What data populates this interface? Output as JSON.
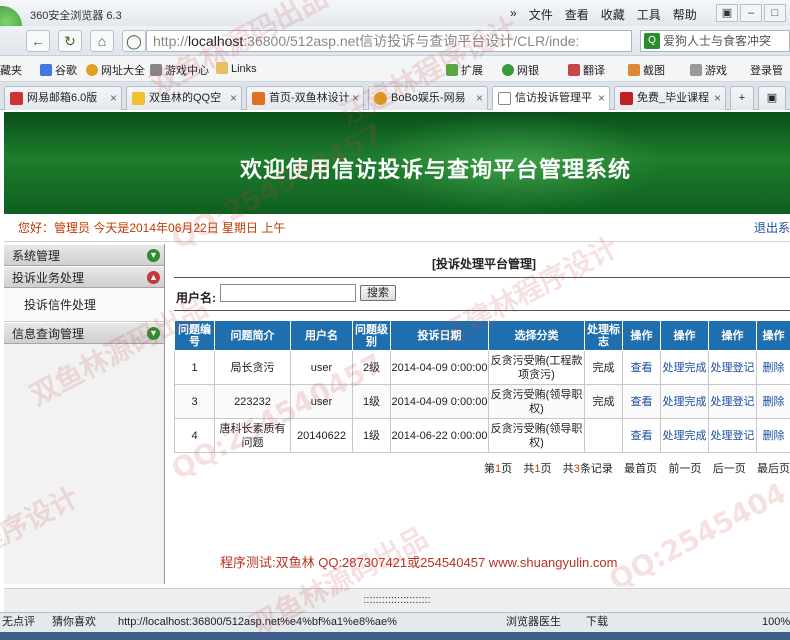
{
  "browser": {
    "title": "360安全浏览器 6.3",
    "menu": [
      "»",
      "文件",
      "查看",
      "收藏",
      "工具",
      "帮助"
    ],
    "url_prefix": "http://",
    "url_host": "localhost",
    "url_rest": ":36800/512asp.net信访投诉与查询平台设计/CLR/inde:",
    "search_text": "爱狗人士与食客冲突",
    "favorites": [
      {
        "label": "藏夹"
      },
      {
        "label": "谷歌"
      },
      {
        "label": "网址大全"
      },
      {
        "label": "游戏中心"
      },
      {
        "label": "Links"
      },
      {
        "label": "扩展"
      },
      {
        "label": "网银"
      },
      {
        "label": "翻译"
      },
      {
        "label": "截图"
      },
      {
        "label": "游戏"
      },
      {
        "label": "登录管"
      }
    ],
    "tabs": [
      {
        "label": "网易邮箱6.0版"
      },
      {
        "label": "双鱼林的QQ空"
      },
      {
        "label": "首页-双鱼林设计"
      },
      {
        "label": "BoBo娱乐-网易"
      },
      {
        "label": "信访投诉管理平"
      },
      {
        "label": "免费_毕业课程"
      }
    ]
  },
  "page": {
    "banner_title": "欢迎使用信访投诉与查询平台管理系统",
    "greeting": "您好：管理员   今天是2014年06月22日  星期日  上午",
    "logout": "退出系",
    "sidebar": {
      "system_mgmt": "系统管理",
      "complaint_mgmt": "投诉业务处理",
      "complaint_letters": "投诉信件处理",
      "info_query": "信息查询管理"
    },
    "panel_title": "[投诉处理平台管理]",
    "username_label": "用户名:",
    "username_value": "",
    "search_button": "搜索",
    "table": {
      "headers": [
        "问题编号",
        "问题简介",
        "用户名",
        "问题级别",
        "投诉日期",
        "选择分类",
        "处理标志",
        "操作",
        "操作",
        "操作",
        "操作"
      ],
      "rows": [
        [
          "1",
          "局长贪污",
          "user",
          "2级",
          "2014-04-09 0:00:00",
          "反贪污受贿(工程款项贪污)",
          "完成",
          "查看",
          "处理完成",
          "处理登记",
          "删除"
        ],
        [
          "3",
          "223232",
          "user",
          "1级",
          "2014-04-09 0:00:00",
          "反贪污受贿(领导职权)",
          "完成",
          "查看",
          "处理完成",
          "处理登记",
          "删除"
        ],
        [
          "4",
          "唐科长素质有问题",
          "20140622",
          "1级",
          "2014-06-22 0:00:00",
          "反贪污受贿(领导职权)",
          "",
          "查看",
          "处理完成",
          "处理登记",
          "删除"
        ]
      ]
    },
    "pager": {
      "current_pre": "第",
      "current_num": "1",
      "current_post": "页",
      "total_pre": "共",
      "total_num": "1",
      "total_post": "页",
      "records_pre": "共",
      "records_num": "3",
      "records_post": "条记录",
      "first": "最首页",
      "prev": "前一页",
      "next": "后一页",
      "last": "最后页"
    },
    "footer": "程序测试:双鱼林 QQ:287307421或254540457 www.shuangyulin.com",
    "dots": "::::::::::::::::::::::"
  },
  "statusbar": {
    "left": "无点评",
    "guess": "猜你喜欢",
    "status_url": "http://localhost:36800/512asp.net%e4%bf%a1%e8%ae%",
    "doctor": "浏览器医生",
    "download": "下载",
    "zoom": "100%"
  },
  "watermarks": [
    "双鱼林源码出品",
    "汪建林程序设计",
    "QQ:254540457",
    "双鱼林源码出品",
    "汪建林程序设计",
    "QQ:254540457",
    "程序设计",
    "双鱼林源码出品",
    "QQ:2545404"
  ]
}
